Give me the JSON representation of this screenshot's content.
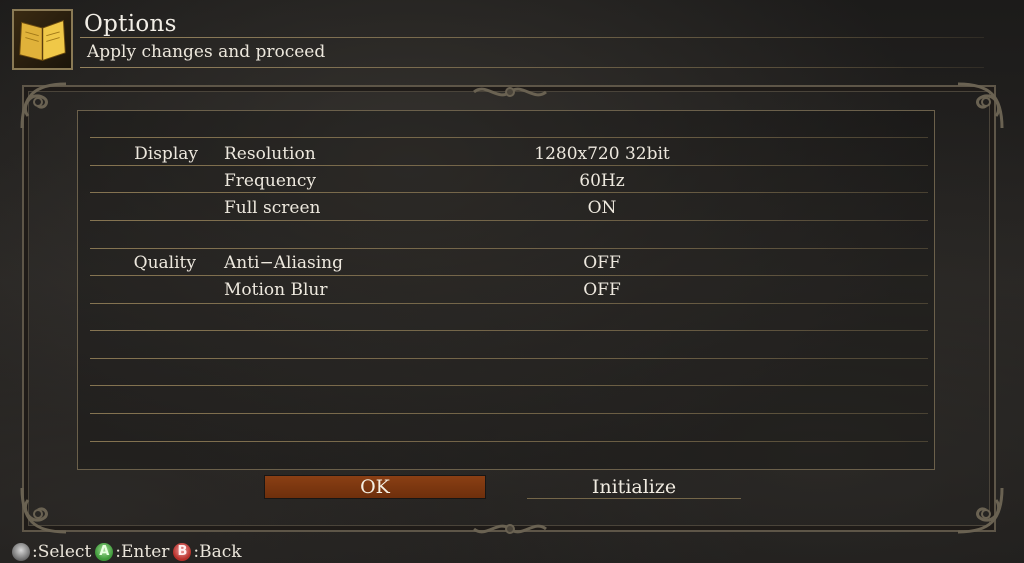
{
  "header": {
    "title": "Options",
    "subtitle": "Apply changes and proceed",
    "icon": "book-icon"
  },
  "settings": {
    "display": {
      "category": "Display",
      "rows": [
        {
          "label": "Resolution",
          "value": "1280x720 32bit"
        },
        {
          "label": "Frequency",
          "value": "60Hz"
        },
        {
          "label": "Full screen",
          "value": "ON"
        }
      ]
    },
    "quality": {
      "category": "Quality",
      "rows": [
        {
          "label": "Anti−Aliasing",
          "value": "OFF"
        },
        {
          "label": "Motion Blur",
          "value": "OFF"
        }
      ]
    }
  },
  "buttons": {
    "ok_label": "OK",
    "initialize_label": "Initialize"
  },
  "footer": {
    "select_label": ":Select",
    "enter_label": ":Enter",
    "back_label": ":Back",
    "enter_glyph": "A",
    "back_glyph": "B"
  },
  "colors": {
    "accent": "#7a3510",
    "line": "#96825a"
  }
}
